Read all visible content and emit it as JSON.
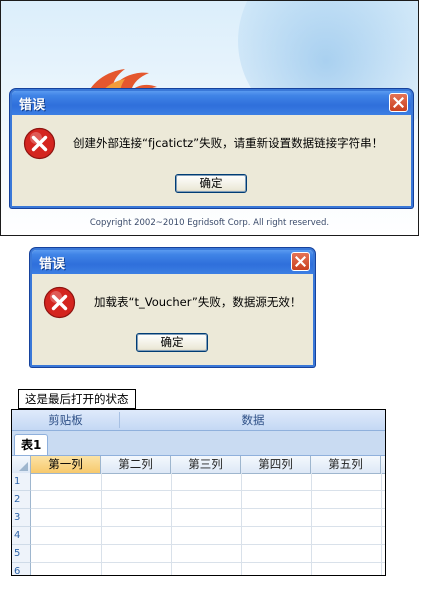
{
  "splash": {
    "copyright": "Copyright 2002~2010 Egridsoft Corp. All right reserved."
  },
  "dialog1": {
    "title": "错误",
    "message": "创建外部连接“fjcatictz”失败，请重新设置数据链接字符串！",
    "ok_label": "确定"
  },
  "dialog2": {
    "title": "错误",
    "message": "加载表“t_Voucher”失败，数据源无效！",
    "ok_label": "确定"
  },
  "caption": "这是最后打开的状态",
  "sheet": {
    "ribbon_groups": [
      "剪贴板",
      "数据"
    ],
    "tab": "表1",
    "columns": [
      "第一列",
      "第二列",
      "第三列",
      "第四列",
      "第五列"
    ],
    "rows": [
      "1",
      "2",
      "3",
      "4",
      "5",
      "6"
    ]
  },
  "colors": {
    "titlebar": "#2f6fdb",
    "dialog_bg": "#ece9d8",
    "error_red": "#d4251f",
    "active_column": "#f7c96c"
  },
  "icons": [
    "firebird-logo",
    "error-icon",
    "close-icon",
    "select-all-corner-icon"
  ]
}
